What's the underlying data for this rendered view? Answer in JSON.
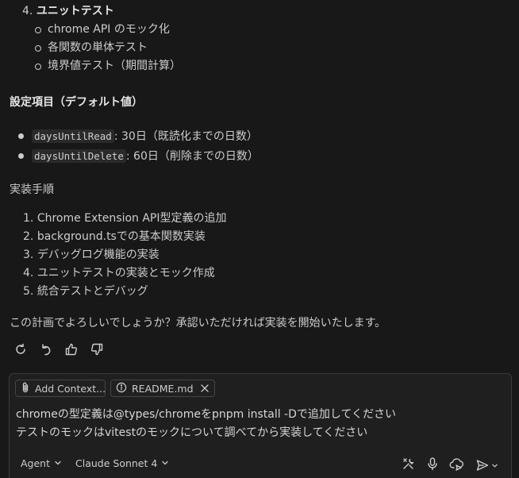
{
  "message": {
    "top_list": {
      "number": "4.",
      "title": "ユニットテスト",
      "sub_items": [
        "chrome API のモック化",
        "各関数の単体テスト",
        "境界値テスト（期間計算）"
      ]
    },
    "settings_heading": "設定項目（デフォルト値）",
    "settings": [
      {
        "code": "daysUntilRead",
        "text": ": 30日（既読化までの日数）"
      },
      {
        "code": "daysUntilDelete",
        "text": ": 60日（削除までの日数）"
      }
    ],
    "steps_heading": "実装手順",
    "steps": [
      {
        "num": "1.",
        "text": "Chrome Extension API型定義の追加"
      },
      {
        "num": "2.",
        "text": "background.tsでの基本関数実装"
      },
      {
        "num": "3.",
        "text": "デバッグログ機能の実装"
      },
      {
        "num": "4.",
        "text": "ユニットテストの実装とモック作成"
      },
      {
        "num": "5.",
        "text": "統合テストとデバッグ"
      }
    ],
    "closing": "この計画でよろしいでしょうか？承認いただければ実装を開始いたします。"
  },
  "actions": {
    "icons": [
      "retry-icon",
      "undo-icon",
      "thumbs-up-icon",
      "thumbs-down-icon"
    ]
  },
  "input": {
    "add_context_label": "Add Context...",
    "file_chip_label": "README.md",
    "lines": [
      "chromeの型定義は@types/chromeをpnpm install -Dで追加してください",
      "テストのモックはvitestのモックについて調べてから実装してください"
    ],
    "mode_label": "Agent",
    "model_label": "Claude Sonnet 4"
  },
  "colors": {
    "background": "#181818",
    "panel": "#1f1f1f",
    "text": "#cccccc"
  }
}
